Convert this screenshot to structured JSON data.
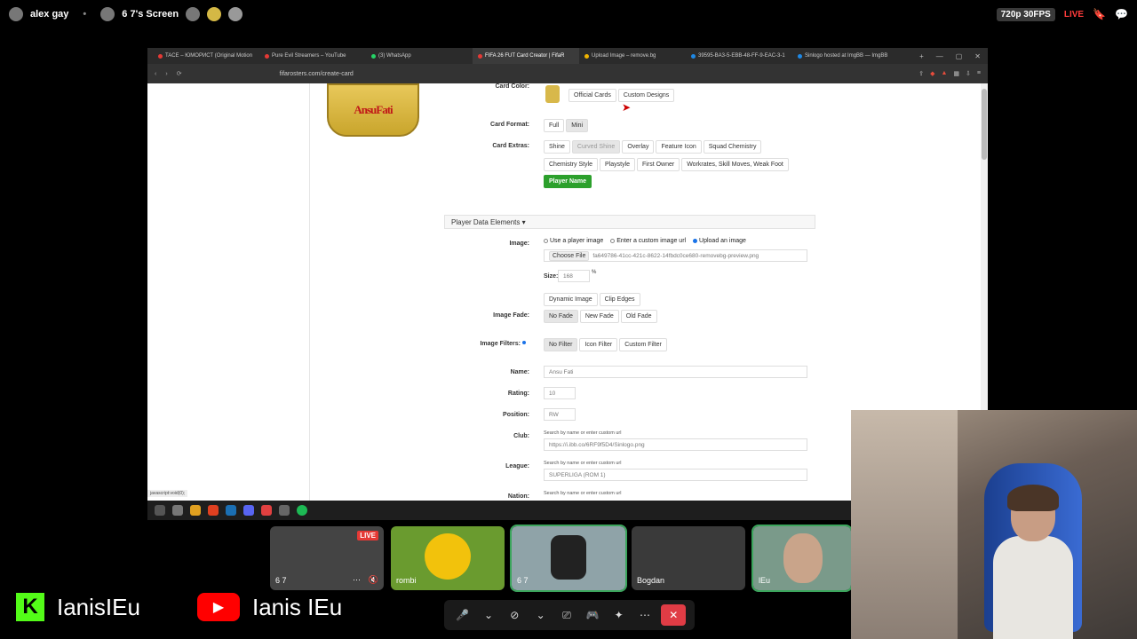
{
  "topbar": {
    "user": "alex gay",
    "server": "6 7's Screen",
    "stream_quality": "720p 30FPS",
    "live": "LIVE"
  },
  "browser": {
    "tabs": [
      {
        "label": "TACE – ЮМОРИСТ (Original Motion",
        "color": "#e53935"
      },
      {
        "label": "Pure Evil Streamers – YouTube",
        "color": "#e53935"
      },
      {
        "label": "(3) WhatsApp",
        "color": "#25d366"
      },
      {
        "label": "FIFA 26 FUT Card Creator | FifaR",
        "color": "#e53935"
      },
      {
        "label": "Upload Image – remove.bg",
        "color": "#f0b400"
      },
      {
        "label": "39595-BA3-5-EBB-48-FF-9-EAC-3-1",
        "color": "#1e88e5"
      },
      {
        "label": "Sinlogo hosted at ImgBB — ImgBB",
        "color": "#1e88e5"
      }
    ],
    "url": "fifarosters.com/create-card"
  },
  "card_image_text": "AnsuFati",
  "form": {
    "card_color_label": "Card Color:",
    "card_color_buttons": [
      "Official Cards",
      "Custom Designs"
    ],
    "card_format_label": "Card Format:",
    "card_format_buttons": [
      "Full",
      "Mini"
    ],
    "card_extras_label": "Card Extras:",
    "card_extras_row1": [
      "Shine",
      "Curved Shine",
      "Overlay",
      "Feature Icon",
      "Squad Chemistry"
    ],
    "card_extras_row2": [
      "Chemistry Style",
      "Playstyle",
      "First Owner",
      "Workrates, Skill Moves, Weak Foot"
    ],
    "player_name_button": "Player Name",
    "section_title": "Player Data Elements ▾",
    "image_label": "Image:",
    "image_options": [
      "Use a player image",
      "Enter a custom image url",
      "Upload an image"
    ],
    "choose_file": "Choose File",
    "file_name": "fa649786-41cc-421c-8622-14fbdc0ce680-removebg-preview.png",
    "size_label": "Size:",
    "size_value": "168",
    "size_unit": "%",
    "image_toggles": [
      "Dynamic Image",
      "Clip Edges"
    ],
    "image_fade_label": "Image Fade:",
    "image_fade_buttons": [
      "No Fade",
      "New Fade",
      "Old Fade"
    ],
    "image_filters_label": "Image Filters:",
    "image_filters_buttons": [
      "No Filter",
      "Icon Filter",
      "Custom Filter"
    ],
    "name_label": "Name:",
    "name_value": "Ansu Fati",
    "rating_label": "Rating:",
    "rating_value": "10",
    "position_label": "Position:",
    "position_value": "RW",
    "club_label": "Club:",
    "club_hint": "Search by name or enter custom url",
    "club_value": "https://i.ibb.co/6RF9f5D4/Sinlogo.png",
    "league_label": "League:",
    "league_hint": "Search by name or enter custom url",
    "league_value": "SUPERLIGA (ROM 1)",
    "nation_label": "Nation:",
    "nation_hint": "Search by name or enter custom url"
  },
  "status_tip": "javascript:void(0);",
  "participants": [
    {
      "name": "6 7",
      "live": "LIVE"
    },
    {
      "name": "rombi"
    },
    {
      "name": "6 7"
    },
    {
      "name": "Bogdan"
    },
    {
      "name": "lEu"
    }
  ],
  "branding": {
    "kick_name": "IanisIEu",
    "youtube_name": "Ianis IEu"
  },
  "colors": {
    "accent_green": "#2ca02c",
    "live_red": "#e53935",
    "youtube_red": "#ff0000",
    "kick_green": "#53fc18"
  }
}
